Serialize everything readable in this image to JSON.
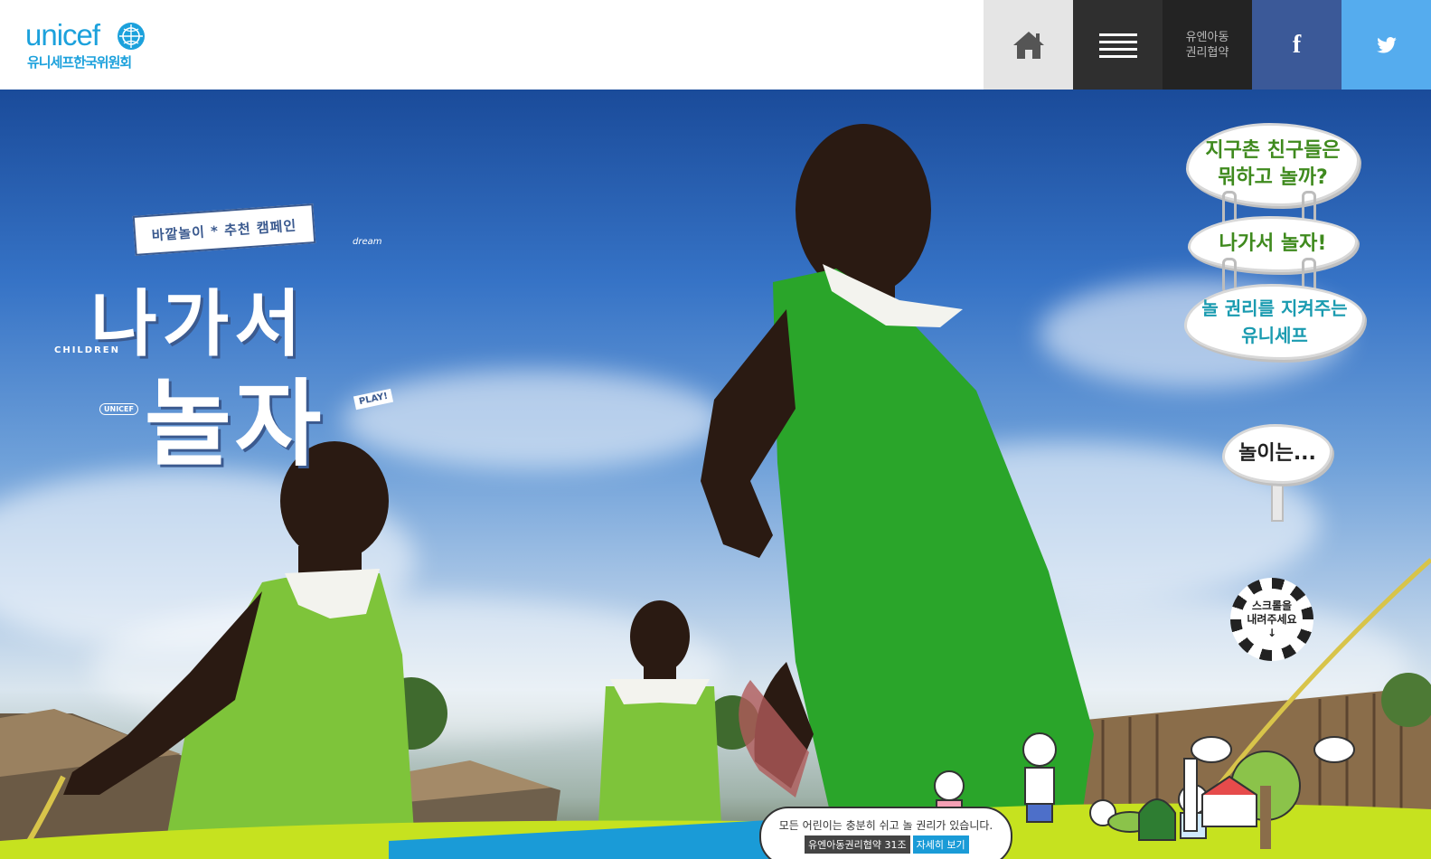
{
  "header": {
    "logo_word": "unicef",
    "logo_korean": "유니세프한국위원회",
    "nav": {
      "home_icon": "home-icon",
      "menu_icon": "hamburger-menu-icon",
      "crc_line1": "유엔아동",
      "crc_line2": "권리협약",
      "facebook_label": "f",
      "twitter_icon": "twitter-bird-icon"
    }
  },
  "hero": {
    "campaign_banner": "바깥놀이 * 추천 캠페인",
    "title_line1": "나가서",
    "title_line2": "놀자",
    "deco_children": "CHILDREN",
    "deco_unicef": "UNICEF",
    "deco_dream": "dream",
    "deco_play": "PLAY!",
    "signs": [
      {
        "line1": "지구촌 친구들은",
        "line2": "뭐하고 놀까?"
      },
      {
        "line1": "나가서 놀자!",
        "line2": ""
      },
      {
        "line1": "놀 권리를 지켜주는",
        "line2": "유니세프"
      }
    ],
    "sign_play": "놀이는...",
    "scroll_line1": "스크롤을",
    "scroll_line2": "내려주세요",
    "scroll_arrow": "↓"
  },
  "bubble": {
    "text": "모든 어린이는 충분히 쉬고 놀 권리가 있습니다.",
    "article": "유엔아동권리협약 31조",
    "more": "자세히 보기"
  },
  "colors": {
    "unicef_blue": "#1ca1dc",
    "facebook": "#3b5998",
    "twitter": "#55acee",
    "grass": "#c6e21f",
    "dress_green": "#2aa52a",
    "sign_green": "#3f8a1e",
    "sign_teal": "#1a9bb0"
  }
}
